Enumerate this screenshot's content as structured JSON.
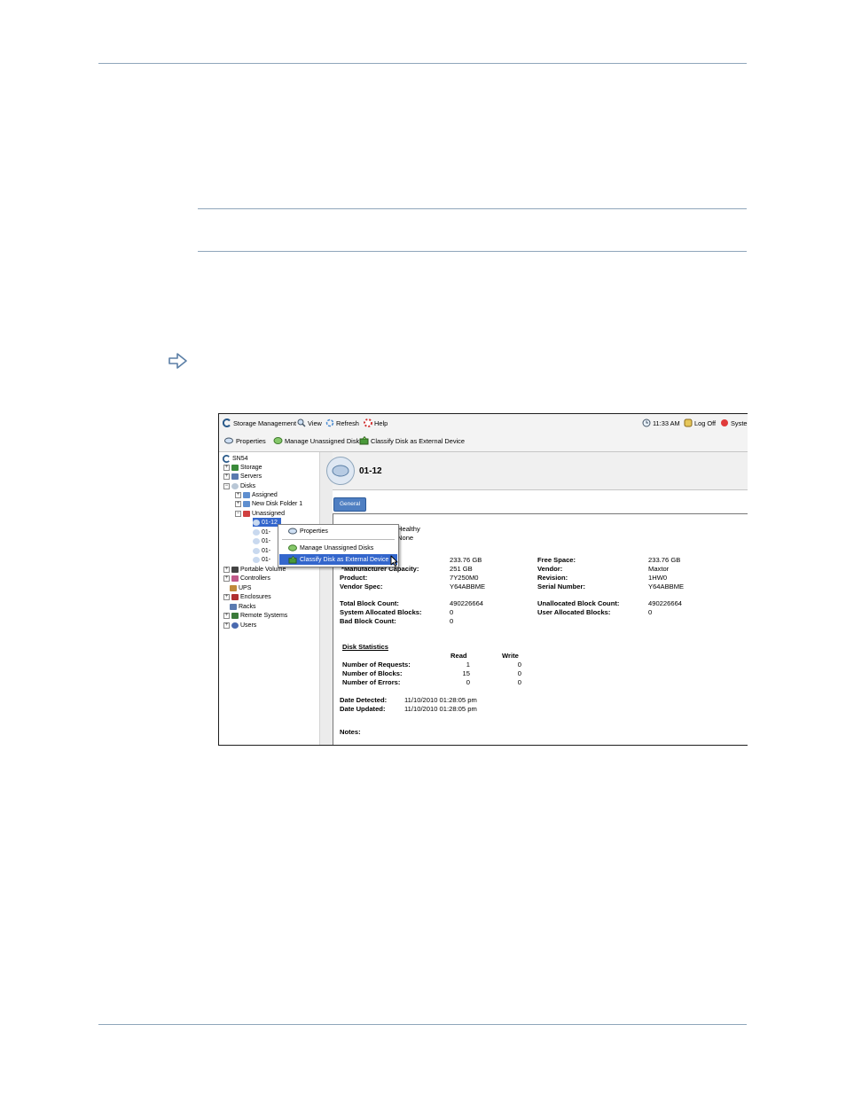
{
  "toolbar_top": {
    "storage_management": "Storage Management",
    "view": "View",
    "refresh": "Refresh",
    "help": "Help",
    "clock": "11:33 AM",
    "log_off": "Log Off",
    "system": "Syste"
  },
  "toolbar_actions": {
    "properties": "Properties",
    "manage_unassigned": "Manage Unassigned Disks",
    "classify": "Classify Disk as External Device"
  },
  "tree": {
    "root": "SN54",
    "storage": "Storage",
    "servers": "Servers",
    "disks": "Disks",
    "assigned": "Assigned",
    "new_disk_folder": "New Disk Folder 1",
    "unassigned": "Unassigned",
    "disk_items": [
      "01-12",
      "01-",
      "01-",
      "01-",
      "01-"
    ],
    "portable_volume": "Portable Volume",
    "controllers": "Controllers",
    "ups": "UPS",
    "enclosures": "Enclosures",
    "racks": "Racks",
    "remote_systems": "Remote Systems",
    "users": "Users"
  },
  "context_menu": {
    "properties": "Properties",
    "manage_unassigned": "Manage Unassigned Disks",
    "classify": "Classify Disk as External Device"
  },
  "detail": {
    "title": "01-12",
    "tab_general": "General",
    "status_value": "Healthy",
    "second_value": "None",
    "left_labels": [
      "*Manufacturer Capacity:",
      "Product:",
      "Vendor Spec:"
    ],
    "left_values": [
      "233.76 GB",
      "251 GB",
      "7Y250M0",
      "Y64ABBME"
    ],
    "right_labels": [
      "Free Space:",
      "Vendor:",
      "Revision:",
      "Serial Number:"
    ],
    "right_values": [
      "233.76 GB",
      "Maxtor",
      "1HW0",
      "Y64ABBME"
    ],
    "block_labels": [
      "Total Block Count:",
      "System Allocated Blocks:",
      "Bad Block Count:"
    ],
    "block_values": [
      "490226664",
      "0",
      "0"
    ],
    "block_right_labels": [
      "Unallocated Block Count:",
      "User Allocated Blocks:"
    ],
    "block_right_values": [
      "490226664",
      "0"
    ],
    "stats_title": "Disk Statistics",
    "stats_col_read": "Read",
    "stats_col_write": "Write",
    "stats_labels": [
      "Number of Requests:",
      "Number of Blocks:",
      "Number of Errors:"
    ],
    "stats_read": [
      "1",
      "15",
      "0"
    ],
    "stats_write": [
      "0",
      "0",
      "0"
    ],
    "date_labels": [
      "Date Detected:",
      "Date Updated:"
    ],
    "date_values": [
      "11/10/2010 01:28:05 pm",
      "11/10/2010 01:28:05 pm"
    ],
    "notes_label": "Notes:"
  },
  "colors": {
    "rule": "#8fa6bb",
    "selection": "#3366cc",
    "tab": "#4f7fc2"
  }
}
